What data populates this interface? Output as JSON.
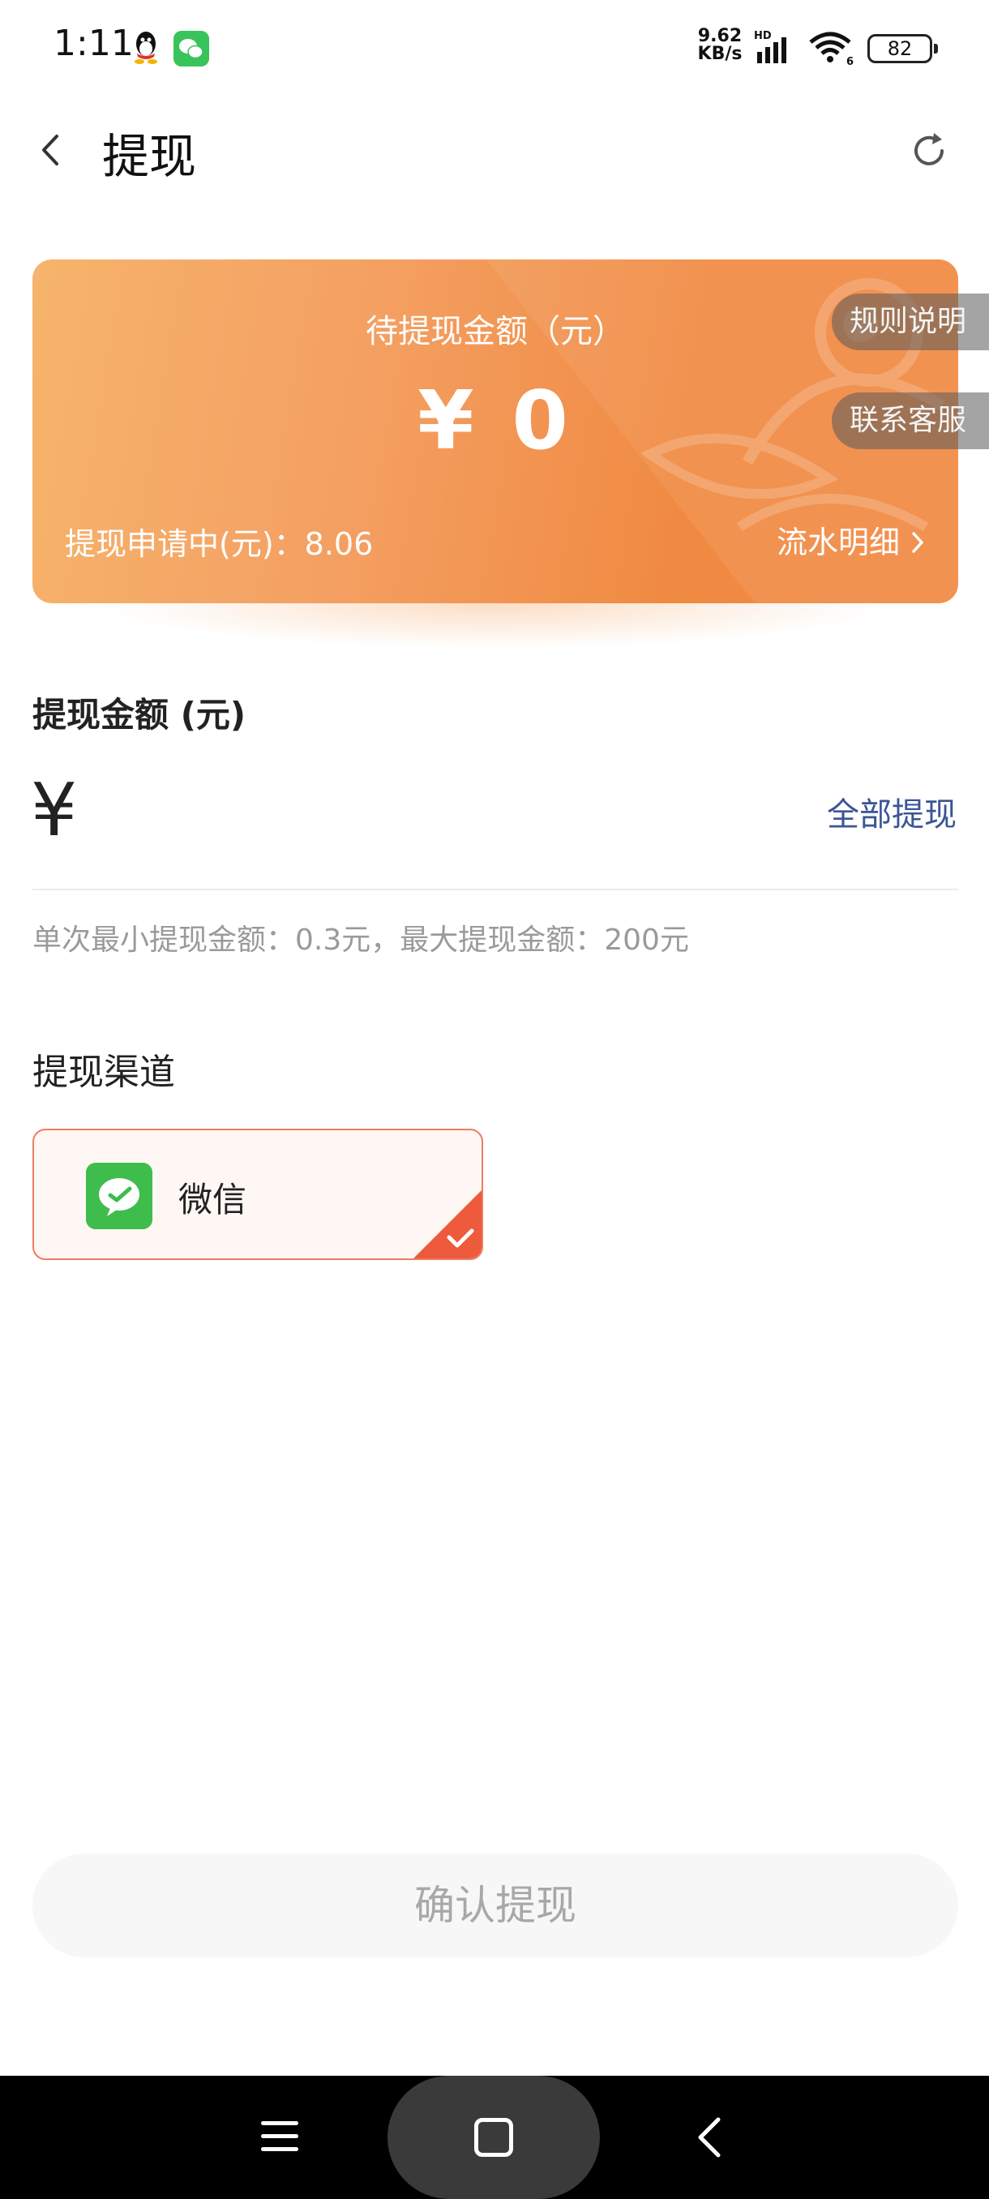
{
  "status_bar": {
    "time": "1:11",
    "net_speed_value": "9.62",
    "net_speed_unit": "KB/s",
    "network_badge": "HD",
    "wifi_badge": "6",
    "battery": "82"
  },
  "header": {
    "title": "提现",
    "back_icon": "chevron-left-icon",
    "refresh_icon": "refresh-icon"
  },
  "balance_card": {
    "label": "待提现金额（元）",
    "amount": "¥ 0",
    "pending_text": "提现申请中(元)：8.06",
    "detail_link": "流水明细",
    "rules_pill": "规则说明",
    "service_pill": "联系客服"
  },
  "withdraw": {
    "section_title": "提现金额 (元)",
    "currency_symbol": "¥",
    "input_value": "",
    "withdraw_all": "全部提现",
    "limit_hint": "单次最小提现金额：0.3元，最大提现金额：200元"
  },
  "channel": {
    "section_title": "提现渠道",
    "options": [
      {
        "label": "微信",
        "icon": "wechat-icon",
        "selected": true
      }
    ]
  },
  "confirm": {
    "label": "确认提现"
  },
  "colors": {
    "card_gradient_start": "#f6b46c",
    "card_gradient_end": "#f08a42",
    "link_blue": "#3b5595",
    "selected_border": "#ee7d64",
    "check_red": "#ee5a3c",
    "wechat_green": "#3fbd4c"
  }
}
